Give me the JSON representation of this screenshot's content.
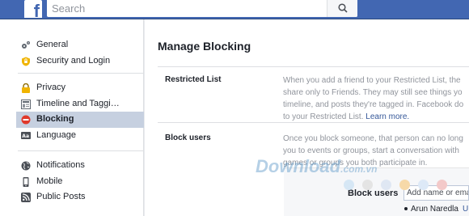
{
  "header": {
    "logo_letter": "f",
    "search_placeholder": "Search"
  },
  "sidebar": {
    "groups": [
      [
        {
          "label": "General",
          "icon": "gear-cog-icon"
        },
        {
          "label": "Security and Login",
          "icon": "security-badge-icon"
        }
      ],
      [
        {
          "label": "Privacy",
          "icon": "lock-icon"
        },
        {
          "label": "Timeline and Taggi…",
          "icon": "timeline-icon"
        },
        {
          "label": "Blocking",
          "icon": "blocking-icon",
          "active": true
        },
        {
          "label": "Language",
          "icon": "language-icon"
        }
      ],
      [
        {
          "label": "Notifications",
          "icon": "globe-icon"
        },
        {
          "label": "Mobile",
          "icon": "mobile-icon"
        },
        {
          "label": "Public Posts",
          "icon": "rss-icon"
        }
      ]
    ]
  },
  "main": {
    "title": "Manage Blocking",
    "restricted": {
      "label": "Restricted List",
      "lines": [
        "When you add a friend to your Restricted List, the",
        "share only to Friends. They may still see things yo",
        "timeline, and posts they're tagged in. Facebook do",
        "to your Restricted List."
      ],
      "learn_more": "Learn more."
    },
    "block_users": {
      "label": "Block users",
      "lines": [
        "Once you block someone, that person can no long",
        "you to events or groups, start a conversation with",
        "games or groups you both participate in."
      ],
      "panel_label": "Block users",
      "input_placeholder": "Add name or ema",
      "blocked_user": "Arun Naredla",
      "unblock_partial": "U"
    }
  },
  "watermark": {
    "text": "Download",
    "suffix": ".com.vn",
    "dot_colors": [
      "#d6e7f5",
      "#e4e4e4",
      "#dfe7f3",
      "#f7d9a8",
      "#dde9f7",
      "#f3c9c9"
    ]
  },
  "colors": {
    "brand": "#4267b2",
    "link": "#365899",
    "active_bg": "#c6d0e0"
  }
}
